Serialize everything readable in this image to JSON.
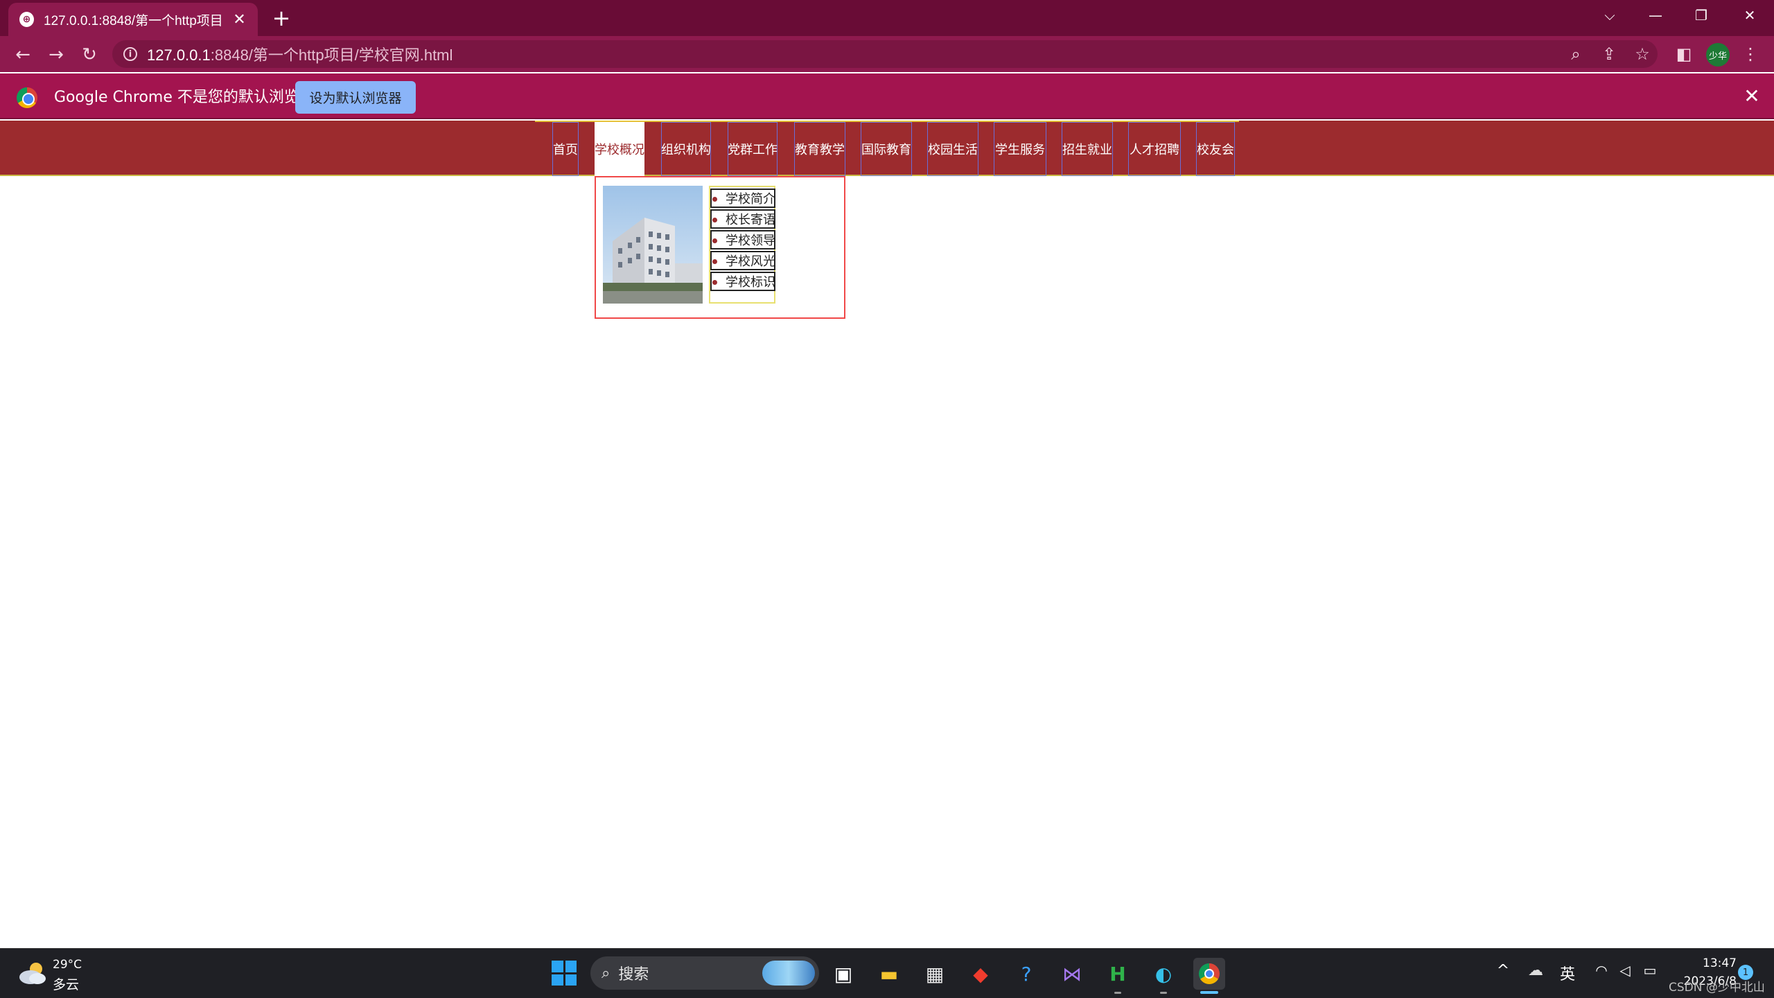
{
  "browser": {
    "tab_title": "127.0.0.1:8848/第一个http项目/学校官网.html",
    "tab_close": "✕",
    "new_tab": "+",
    "window_controls": {
      "tab_search": "⌵",
      "minimize": "—",
      "restore": "❐",
      "close": "✕"
    },
    "url_host": "127.0.0.1",
    "url_rest": ":8848/第一个http项目/学校官网.html",
    "profile_label": "少华"
  },
  "infobar": {
    "message": "Google Chrome 不是您的默认浏览器",
    "button_label": "设为默认浏览器",
    "close": "✕"
  },
  "site_nav": {
    "items": [
      {
        "label": "首页"
      },
      {
        "label": "学校概况"
      },
      {
        "label": "组织机构"
      },
      {
        "label": "党群工作"
      },
      {
        "label": "教育教学"
      },
      {
        "label": "国际教育"
      },
      {
        "label": "校园生活"
      },
      {
        "label": "学生服务"
      },
      {
        "label": "招生就业"
      },
      {
        "label": "人才招聘"
      },
      {
        "label": "校友会"
      }
    ],
    "active_index": 1
  },
  "dropdown": {
    "items": [
      {
        "label": "学校简介"
      },
      {
        "label": "校长寄语"
      },
      {
        "label": "学校领导"
      },
      {
        "label": "学校风光"
      },
      {
        "label": "学校标识"
      }
    ]
  },
  "taskbar": {
    "weather_temp": "29°C",
    "weather_desc": "多云",
    "search_label": "搜索",
    "ime": "英",
    "clock_time": "13:47",
    "clock_date": "2023/6/8",
    "notification_count": "1",
    "watermark": "CSDN @少中北山"
  },
  "colors": {
    "tab_strip": "#690c36",
    "toolbar": "#8e1a4e",
    "infobar": "#a3144f",
    "nav_bg": "#9c2b2e",
    "dropdown_border": "#f04848"
  }
}
